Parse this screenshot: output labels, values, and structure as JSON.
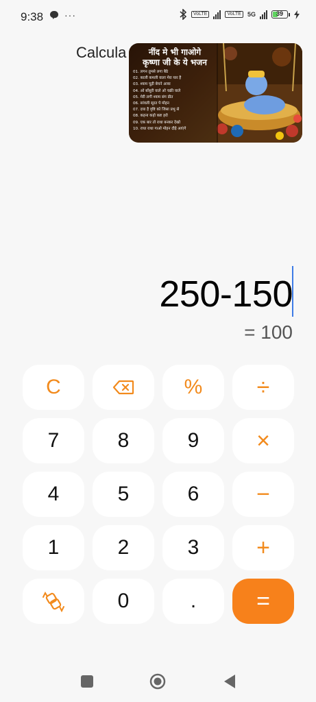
{
  "status_bar": {
    "time": "9:38",
    "overflow": "···",
    "net_badge_1": "VoLTE",
    "net_badge_2": "VoLTE",
    "net_5g": "5G",
    "battery_level": "39",
    "battery_percent": 39,
    "icons": [
      "chat-bubble-icon",
      "bluetooth-icon",
      "signal-icon",
      "battery-icon",
      "charging-icon"
    ]
  },
  "header": {
    "title": "Calcula"
  },
  "ad": {
    "title_line1": "नींद मे भी गाओगे",
    "title_line2": "कृष्णा जी के ये भजन",
    "list": [
      "01. लगन तुमसे लगा बैठे",
      "02. काली कमली वाला मेरा यार है",
      "03. श्याम चूड़ी बेचने आया",
      "04. ओ बाँसुरी वाले ओ चक्री वाले",
      "05. मेरी लगी श्याम संग प्रीत",
      "06. सांवली सूरत पे मोहन",
      "07. दया है वृष्टि को जिसा प्रभु से",
      "08. कहना कहो कष्ट हरो",
      "09. एक बार तो राधा बनकर देखो",
      "10. राधा राधा गाओ मोहन दौड़े आएंगे"
    ]
  },
  "display": {
    "expression": "250-150",
    "result": "= 100"
  },
  "keypad": {
    "clear": "C",
    "backspace_icon": "backspace-icon",
    "percent": "%",
    "divide": "÷",
    "seven": "7",
    "eight": "8",
    "nine": "9",
    "multiply": "×",
    "four": "4",
    "five": "5",
    "six": "6",
    "minus": "−",
    "one": "1",
    "two": "2",
    "three": "3",
    "plus": "+",
    "mode_icon": "swap-mode-icon",
    "zero": "0",
    "dot": ".",
    "equals": "=",
    "accent_color": "#f28a1c",
    "equals_bg": "#f7811b"
  },
  "nav_bar": {
    "icons": [
      "recents-square-icon",
      "home-circle-icon",
      "back-triangle-icon"
    ]
  }
}
